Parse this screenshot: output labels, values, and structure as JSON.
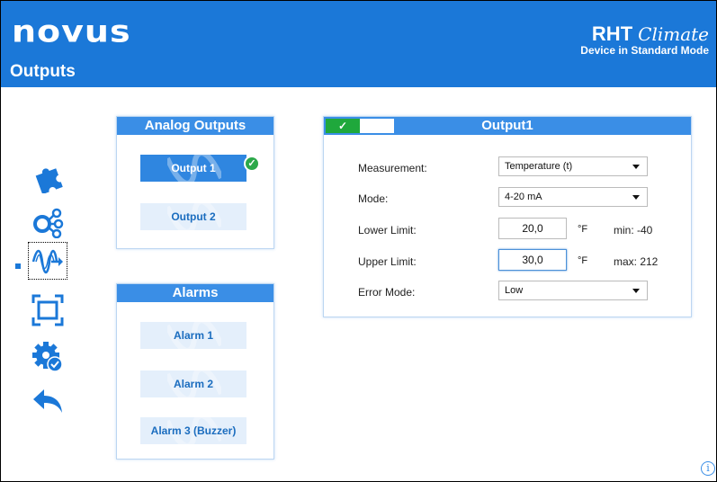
{
  "header": {
    "logo": "novus",
    "page_title": "Outputs",
    "product_name": "RHT",
    "product_sub": "Climate",
    "device_mode": "Device in Standard Mode",
    "color": "#1b78d8"
  },
  "sidebar": {
    "items": [
      {
        "icon": "puzzle-icon",
        "selected": false
      },
      {
        "icon": "connections-icon",
        "selected": false
      },
      {
        "icon": "wave-output-icon",
        "selected": true
      },
      {
        "icon": "frame-icon",
        "selected": false
      },
      {
        "icon": "settings-check-icon",
        "selected": false
      },
      {
        "icon": "back-arrow-icon",
        "selected": false
      }
    ]
  },
  "analog_outputs": {
    "title": "Analog Outputs",
    "buttons": [
      {
        "label": "Output 1",
        "active": true,
        "configured": true,
        "badge": "✓"
      },
      {
        "label": "Output 2",
        "active": false
      }
    ]
  },
  "alarms": {
    "title": "Alarms",
    "buttons": [
      {
        "label": "Alarm 1"
      },
      {
        "label": "Alarm 2"
      },
      {
        "label": "Alarm 3 (Buzzer)"
      }
    ]
  },
  "output_panel": {
    "title": "Output1",
    "status_check": "✓",
    "measurement": {
      "label": "Measurement:",
      "value": "Temperature (t)"
    },
    "mode": {
      "label": "Mode:",
      "value": "4-20 mA"
    },
    "lower_limit": {
      "label": "Lower Limit:",
      "value": "20,0",
      "unit": "°F",
      "limit": "min: -40"
    },
    "upper_limit": {
      "label": "Upper Limit:",
      "value": "30,0",
      "unit": "°F",
      "limit": "max: 212"
    },
    "error_mode": {
      "label": "Error Mode:",
      "value": "Low"
    }
  },
  "info": "i",
  "colors": {
    "accent": "#1b78d8",
    "panel_title": "#3a8ee6",
    "ok": "#1fa83c"
  }
}
